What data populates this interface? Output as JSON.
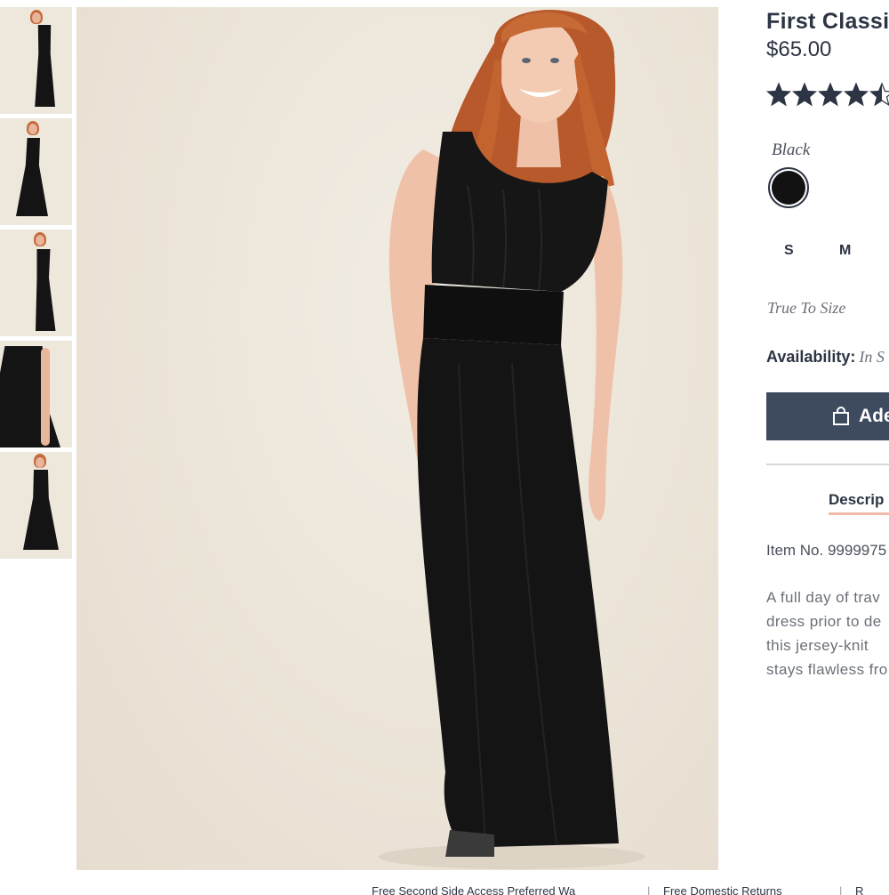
{
  "product": {
    "title": "First Classi",
    "price": "$65.00",
    "rating": 4.5,
    "rating_max": 5,
    "star_color": "#2d3443",
    "color_label": "Black",
    "swatch_color": "#121212",
    "sizes": [
      "S",
      "M"
    ],
    "fit": "True To Size",
    "availability_label": "Availability:",
    "availability_value": "In S",
    "add_button_label": "Ade",
    "button_color": "#3e4a5e",
    "tab_label": "Descrip",
    "item_number": "Item No. 9999975",
    "description_lines": [
      "A full day of trav",
      "dress prior to de",
      "this jersey-knit",
      "stays flawless fro"
    ]
  },
  "gallery": {
    "thumbnail_count": 5
  },
  "footer": {
    "links": [
      "Free Second Side Access Preferred Wa",
      "Free Domestic Returns",
      "R"
    ]
  }
}
